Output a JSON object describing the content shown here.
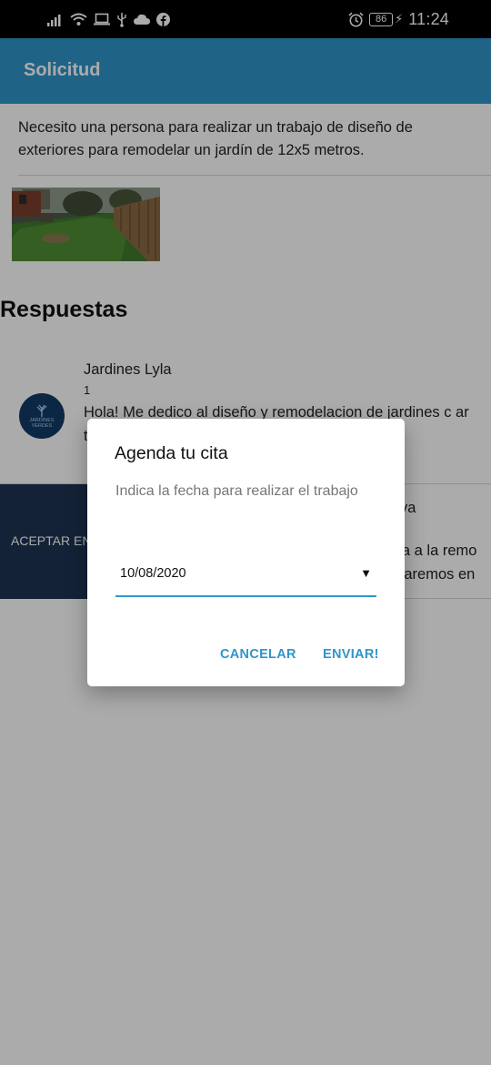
{
  "status_bar": {
    "time": "11:24",
    "battery": "86",
    "icons": [
      "signal-icon",
      "wifi-icon",
      "laptop-icon",
      "usb-icon",
      "cloud-icon",
      "facebook-icon",
      "alarm-icon",
      "battery-icon",
      "charging-icon"
    ]
  },
  "app_bar": {
    "title": "Solicitud"
  },
  "request": {
    "description": "Necesito una persona para realizar un trabajo de diseño de exteriores para remodelar un jardín de 12x5 metros.",
    "photo": "garden-photo"
  },
  "responses": {
    "title": "Respuestas",
    "items": [
      {
        "name": "Jardines Lyla",
        "rating": "1",
        "text": "Hola! Me dedico al diseño y remodelacion de jardines c                                                    ar tu j",
        "avatar_text": "JARDINES VERDES"
      }
    ],
    "accept_button": "ACEPTAR EN",
    "second_fragments": [
      "va",
      "ica a la remo",
      "udaremos en"
    ]
  },
  "dialog": {
    "title": "Agenda tu cita",
    "subtitle": "Indica la fecha para realizar el trabajo",
    "date_value": "10/08/2020",
    "cancel_label": "CANCELAR",
    "send_label": "ENVIAR!"
  },
  "colors": {
    "app_bar": "#2f96c9",
    "accent": "#2f96c9",
    "accept_button": "#1d3352",
    "avatar": "#123b66"
  }
}
